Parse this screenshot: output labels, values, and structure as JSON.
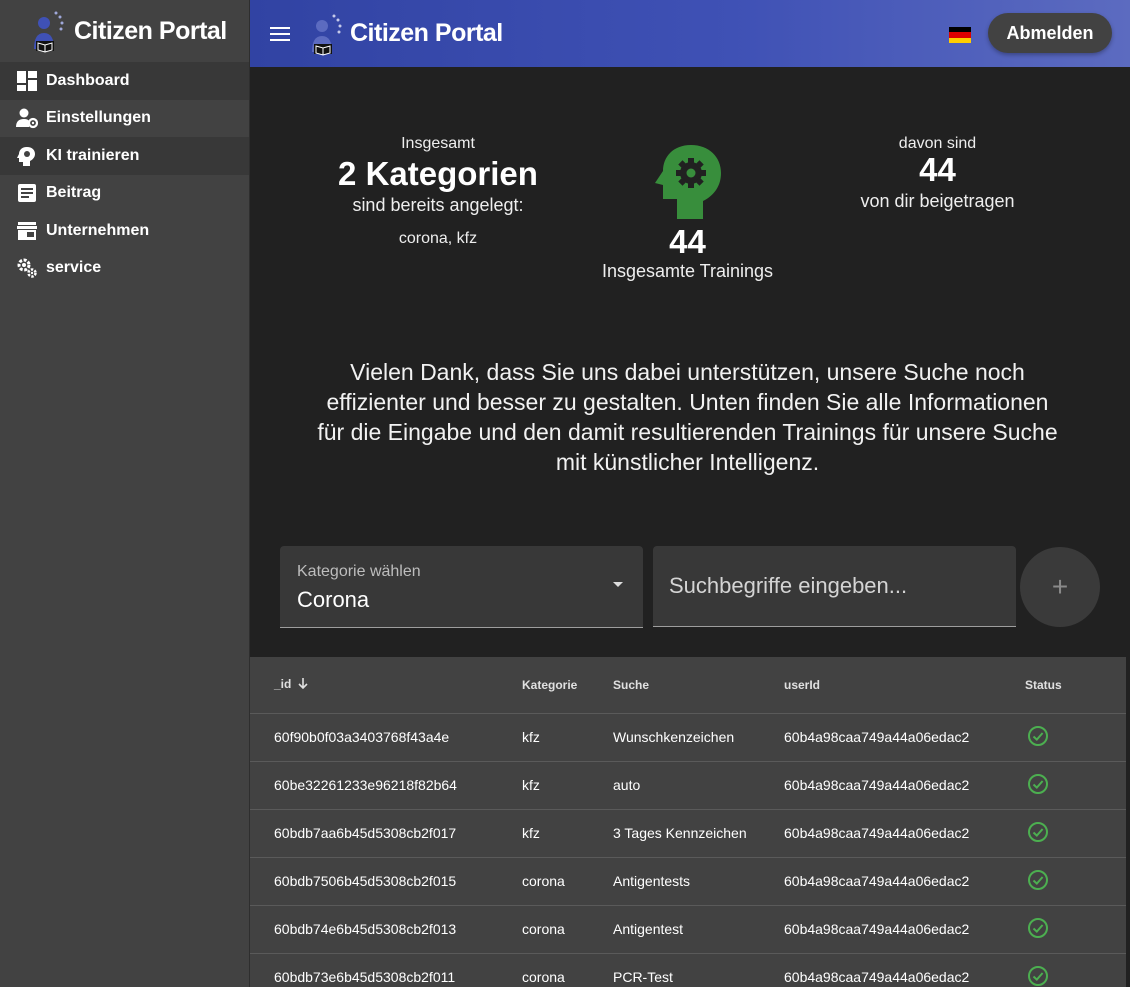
{
  "brand": {
    "name": "Citizen Portal"
  },
  "sidebar": {
    "items": [
      {
        "label": "Dashboard",
        "icon": "dashboard-icon"
      },
      {
        "label": "Einstellungen",
        "icon": "user-settings-icon"
      },
      {
        "label": "KI trainieren",
        "icon": "brain-icon"
      },
      {
        "label": "Beitrag",
        "icon": "article-icon"
      },
      {
        "label": "Unternehmen",
        "icon": "store-icon"
      },
      {
        "label": "service",
        "icon": "gears-icon"
      }
    ]
  },
  "header": {
    "title": "Citizen Portal",
    "logout_label": "Abmelden",
    "language_flag": "de-flag-icon"
  },
  "stats": {
    "left": {
      "intro": "Insgesamt",
      "count": "2 Kategorien",
      "suffix": "sind bereits angelegt:",
      "categories": "corona, kfz"
    },
    "center": {
      "count": "44",
      "label": "Insgesamte Trainings"
    },
    "right": {
      "intro": "davon sind",
      "count": "44",
      "suffix": "von dir beigetragen"
    }
  },
  "thanks_text": "Vielen Dank, dass Sie uns dabei unterstützen, unsere Suche noch effizienter und besser zu gestalten. Unten finden Sie alle Informationen für die Eingabe und den damit resultierenden Trainings für unsere Suche mit künstlicher Intelligenz.",
  "form": {
    "category_label": "Kategorie wählen",
    "category_value": "Corona",
    "search_placeholder": "Suchbegriffe eingeben...",
    "add_label": "+"
  },
  "table": {
    "columns": [
      "_id",
      "Kategorie",
      "Suche",
      "userId",
      "Status"
    ],
    "rows": [
      {
        "id": "60f90b0f03a3403768f43a4e",
        "kategorie": "kfz",
        "suche": "Wunschkenzeichen",
        "userId": "60b4a98caa749a44a06edac2",
        "status": "ok"
      },
      {
        "id": "60be32261233e96218f82b64",
        "kategorie": "kfz",
        "suche": "auto",
        "userId": "60b4a98caa749a44a06edac2",
        "status": "ok"
      },
      {
        "id": "60bdb7aa6b45d5308cb2f017",
        "kategorie": "kfz",
        "suche": "3 Tages Kennzeichen",
        "userId": "60b4a98caa749a44a06edac2",
        "status": "ok"
      },
      {
        "id": "60bdb7506b45d5308cb2f015",
        "kategorie": "corona",
        "suche": "Antigentests",
        "userId": "60b4a98caa749a44a06edac2",
        "status": "ok"
      },
      {
        "id": "60bdb74e6b45d5308cb2f013",
        "kategorie": "corona",
        "suche": "Antigentest",
        "userId": "60b4a98caa749a44a06edac2",
        "status": "ok"
      },
      {
        "id": "60bdb73e6b45d5308cb2f011",
        "kategorie": "corona",
        "suche": "PCR-Test",
        "userId": "60b4a98caa749a44a06edac2",
        "status": "ok"
      }
    ]
  },
  "colors": {
    "primary": "#3f51b5",
    "success": "#4caf50",
    "brain": "#388e3c"
  }
}
